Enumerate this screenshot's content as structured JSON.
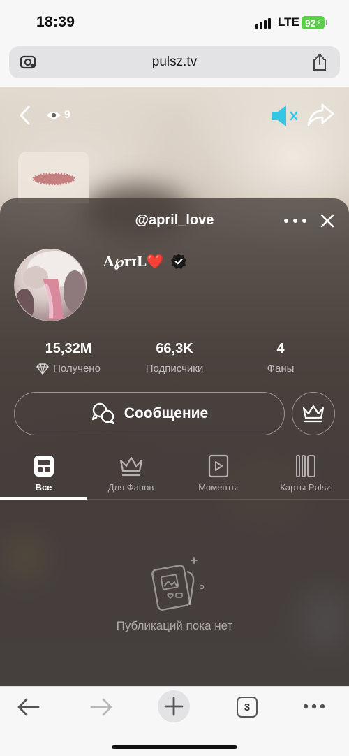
{
  "status_bar": {
    "time": "18:39",
    "network": "LTE",
    "battery": "92"
  },
  "browser": {
    "url": "pulsz.tv",
    "open_tabs": "3"
  },
  "video_overlay": {
    "view_count": "9",
    "accent_color": "#35c6e6"
  },
  "profile": {
    "username": "@april_love",
    "display_name": "A℘rɪL❤️",
    "verified": true,
    "stats": [
      {
        "value": "15,32M",
        "label": "Получено",
        "icon": "diamond-icon"
      },
      {
        "value": "66,3K",
        "label": "Подписчики"
      },
      {
        "value": "4",
        "label": "Фаны"
      }
    ],
    "message_button": "Сообщение"
  },
  "tabs": [
    {
      "label": "Все",
      "icon": "grid-icon",
      "active": true
    },
    {
      "label": "Для Фанов",
      "icon": "crown-icon",
      "active": false
    },
    {
      "label": "Моменты",
      "icon": "play-icon",
      "active": false
    },
    {
      "label": "Карты Pulsz",
      "icon": "cards-icon",
      "active": false
    }
  ],
  "empty_state": {
    "text": "Публикаций пока нет",
    "icon": "photo-cards-icon"
  }
}
